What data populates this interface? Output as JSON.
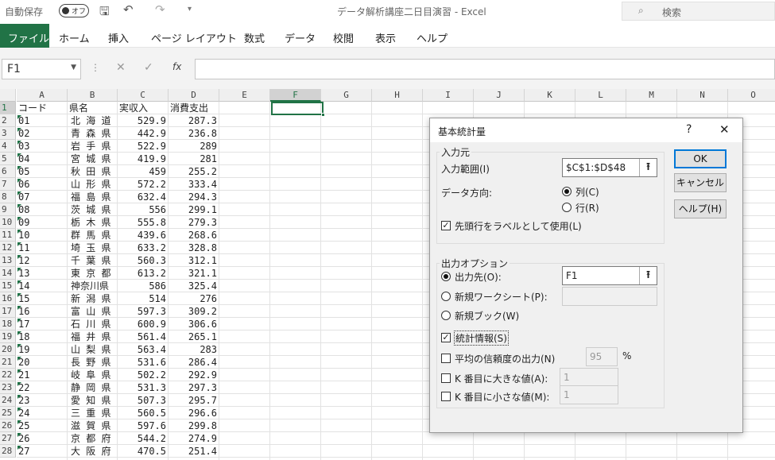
{
  "titlebar": {
    "autosave_label": "自動保存",
    "toggle_label": "オフ",
    "window_title": "データ解析講座二日目演習  -  Excel",
    "search_placeholder": "検索"
  },
  "ribbon_tabs": [
    "ファイル",
    "ホーム",
    "挿入",
    "ページ レイアウト",
    "数式",
    "データ",
    "校閲",
    "表示",
    "ヘルプ"
  ],
  "formula_bar": {
    "name_box": "F1",
    "fx": "fx"
  },
  "grid": {
    "columns": [
      "A",
      "B",
      "C",
      "D",
      "E",
      "F",
      "G",
      "H",
      "I",
      "J",
      "K",
      "L",
      "M",
      "N",
      "O"
    ],
    "selected_column": "F",
    "selected_cell": "F1",
    "header_row": [
      "コード",
      "県名",
      "実収入",
      "消費支出"
    ],
    "rows": [
      [
        "01",
        "北 海 道",
        "529.9",
        "287.3"
      ],
      [
        "02",
        "青 森 県",
        "442.9",
        "236.8"
      ],
      [
        "03",
        "岩 手 県",
        "522.9",
        "289"
      ],
      [
        "04",
        "宮 城 県",
        "419.9",
        "281"
      ],
      [
        "05",
        "秋 田 県",
        "459",
        "255.2"
      ],
      [
        "06",
        "山 形 県",
        "572.2",
        "333.4"
      ],
      [
        "07",
        "福 島 県",
        "632.4",
        "294.3"
      ],
      [
        "08",
        "茨 城 県",
        "556",
        "299.1"
      ],
      [
        "09",
        "栃 木 県",
        "555.8",
        "279.3"
      ],
      [
        "10",
        "群 馬 県",
        "439.6",
        "268.6"
      ],
      [
        "11",
        "埼 玉 県",
        "633.2",
        "328.8"
      ],
      [
        "12",
        "千 葉 県",
        "560.3",
        "312.1"
      ],
      [
        "13",
        "東 京 都",
        "613.2",
        "321.1"
      ],
      [
        "14",
        "神奈川県",
        "586",
        "325.4"
      ],
      [
        "15",
        "新 潟 県",
        "514",
        "276"
      ],
      [
        "16",
        "富 山 県",
        "597.3",
        "309.2"
      ],
      [
        "17",
        "石 川 県",
        "600.9",
        "306.6"
      ],
      [
        "18",
        "福 井 県",
        "561.4",
        "265.1"
      ],
      [
        "19",
        "山 梨 県",
        "563.4",
        "283"
      ],
      [
        "20",
        "長 野 県",
        "531.6",
        "286.4"
      ],
      [
        "21",
        "岐 阜 県",
        "502.2",
        "292.9"
      ],
      [
        "22",
        "静 岡 県",
        "531.3",
        "297.3"
      ],
      [
        "23",
        "愛 知 県",
        "507.3",
        "295.7"
      ],
      [
        "24",
        "三 重 県",
        "560.5",
        "296.6"
      ],
      [
        "25",
        "滋 賀 県",
        "597.6",
        "299.8"
      ],
      [
        "26",
        "京 都 府",
        "544.2",
        "274.9"
      ],
      [
        "27",
        "大 阪 府",
        "470.5",
        "251.4"
      ]
    ]
  },
  "dialog": {
    "title": "基本統計量",
    "help_glyph": "?",
    "close_glyph": "✕",
    "input_group_label": "入力元",
    "input_range_label": "入力範囲(I)",
    "input_range_value": "$C$1:$D$48",
    "direction_label": "データ方向:",
    "direction_col": "列(C)",
    "direction_row": "行(R)",
    "labels_first_row": "先頭行をラベルとして使用(L)",
    "output_group_label": "出力オプション",
    "out_range_label": "出力先(O):",
    "out_range_value": "F1",
    "new_sheet_label": "新規ワークシート(P):",
    "new_book_label": "新規ブック(W)",
    "summary_stats_label": "統計情報(S)",
    "confidence_label": "平均の信頼度の出力(N)",
    "confidence_value": "95",
    "percent": "%",
    "kth_largest_label": "K 番目に大きな値(A):",
    "kth_largest_value": "1",
    "kth_smallest_label": "K 番目に小さな値(M):",
    "kth_smallest_value": "1",
    "ok": "OK",
    "cancel": "キャンセル",
    "help": "ヘルプ(H)"
  },
  "colors": {
    "accent": "#217346",
    "dialog_bg": "#f0f0f0",
    "default_btn_border": "#0078d7"
  }
}
